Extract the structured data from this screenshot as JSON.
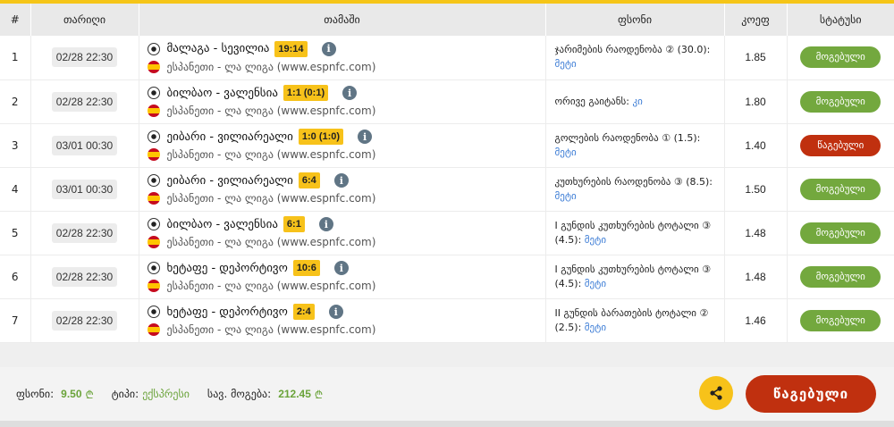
{
  "headers": {
    "num": "#",
    "date": "თარიღი",
    "match": "თამაში",
    "bet": "ფსონი",
    "coef": "კოეფ",
    "status": "სტატუსი"
  },
  "rows": [
    {
      "num": "1",
      "date": "02/28 22:30",
      "match": "მალაგა - სევილია",
      "score": "19:14",
      "league": "ესპანეთი - ლა ლიგა (www.espnfc.com)",
      "bet_text": "ჯარიმების რაოდენობა ② (30.0):",
      "bet_more": "მეტი",
      "coef": "1.85",
      "status": "მოგებული",
      "status_type": "won"
    },
    {
      "num": "2",
      "date": "02/28 22:30",
      "match": "ბილბაო - ვალენსია",
      "score": "1:1 (0:1)",
      "league": "ესპანეთი - ლა ლიგა (www.espnfc.com)",
      "bet_text": "ორივე გაიტანს:",
      "bet_more": "კი",
      "coef": "1.80",
      "status": "მოგებული",
      "status_type": "won"
    },
    {
      "num": "3",
      "date": "03/01 00:30",
      "match": "ეიბარი - ვილიარეალი",
      "score": "1:0 (1:0)",
      "league": "ესპანეთი - ლა ლიგა (www.espnfc.com)",
      "bet_text": "გოლების რაოდენობა ① (1.5):",
      "bet_more": "მეტი",
      "coef": "1.40",
      "status": "წაგებული",
      "status_type": "lost"
    },
    {
      "num": "4",
      "date": "03/01 00:30",
      "match": "ეიბარი - ვილიარეალი",
      "score": "6:4",
      "league": "ესპანეთი - ლა ლიგა (www.espnfc.com)",
      "bet_text": "კუთხურების რაოდენობა ③ (8.5):",
      "bet_more": "მეტი",
      "coef": "1.50",
      "status": "მოგებული",
      "status_type": "won"
    },
    {
      "num": "5",
      "date": "02/28 22:30",
      "match": "ბილბაო - ვალენსია",
      "score": "6:1",
      "league": "ესპანეთი - ლა ლიგა (www.espnfc.com)",
      "bet_text": "I გუნდის კუთხურების ტოტალი ③ (4.5):",
      "bet_more": "მეტი",
      "coef": "1.48",
      "status": "მოგებული",
      "status_type": "won"
    },
    {
      "num": "6",
      "date": "02/28 22:30",
      "match": "ხეტაფე - დეპორტივო",
      "score": "10:6",
      "league": "ესპანეთი - ლა ლიგა (www.espnfc.com)",
      "bet_text": "I გუნდის კუთხურების ტოტალი ③ (4.5):",
      "bet_more": "მეტი",
      "coef": "1.48",
      "status": "მოგებული",
      "status_type": "won"
    },
    {
      "num": "7",
      "date": "02/28 22:30",
      "match": "ხეტაფე - დეპორტივო",
      "score": "2:4",
      "league": "ესპანეთი - ლა ლიგა (www.espnfc.com)",
      "bet_text": "II გუნდის ბარათების ტოტალი ② (2.5):",
      "bet_more": "მეტი",
      "coef": "1.46",
      "status": "მოგებული",
      "status_type": "won"
    }
  ],
  "footer": {
    "stake_label": "ფსონი:",
    "stake_value": "9.50",
    "type_label": "ტიპი:",
    "type_value": "ექსპრესი",
    "total_label": "სავ. მოგება:",
    "total_value": "212.45",
    "currency_symbol": "₾",
    "result_button": "წაგებული"
  },
  "icons": {
    "row_sport": "soccer-ball-icon",
    "row_flag": "spain-flag-icon",
    "row_info": "info-icon",
    "share": "share-icon"
  },
  "colors": {
    "accent": "#f5c518",
    "won": "#73a83e",
    "lost": "#c0300f",
    "link": "#3a7bd5"
  }
}
